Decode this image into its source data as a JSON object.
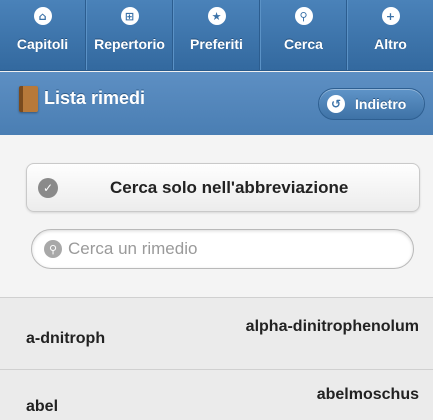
{
  "navbar": {
    "items": [
      {
        "label": "Capitoli",
        "icon": "home-icon",
        "glyph": "⌂"
      },
      {
        "label": "Repertorio",
        "icon": "grid-icon",
        "glyph": "⊞"
      },
      {
        "label": "Preferiti",
        "icon": "star-icon",
        "glyph": "★"
      },
      {
        "label": "Cerca",
        "icon": "search-icon",
        "glyph": "⚲"
      },
      {
        "label": "Altro",
        "icon": "plus-icon",
        "glyph": "+"
      }
    ]
  },
  "header": {
    "title": "Lista rimedi",
    "back_label": "Indietro",
    "back_icon": "back-arrow-icon"
  },
  "filter": {
    "label": "Cerca solo nell'abbreviazione",
    "checked": true
  },
  "search": {
    "placeholder": "Cerca un rimedio",
    "value": ""
  },
  "remedies": [
    {
      "abbreviation": "a-dnitroph",
      "name": "alpha-dinitrophenolum"
    },
    {
      "abbreviation": "abel",
      "name": "abelmoschus"
    }
  ],
  "colors": {
    "navbar": "#3b72a8",
    "titlebar": "#5289c0",
    "background": "#f0f0f0"
  }
}
